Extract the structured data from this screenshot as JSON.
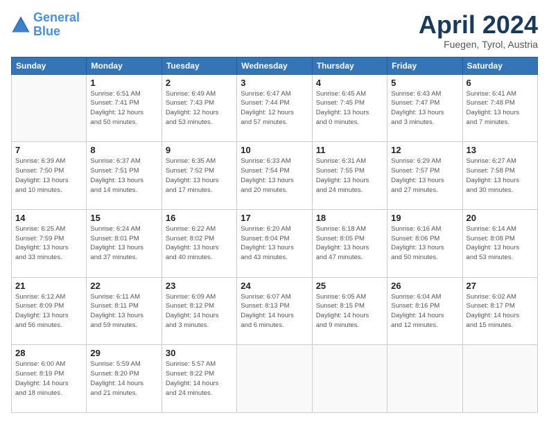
{
  "header": {
    "logo_line1": "General",
    "logo_line2": "Blue",
    "month": "April 2024",
    "location": "Fuegen, Tyrol, Austria"
  },
  "days_of_week": [
    "Sunday",
    "Monday",
    "Tuesday",
    "Wednesday",
    "Thursday",
    "Friday",
    "Saturday"
  ],
  "weeks": [
    [
      {
        "day": "",
        "info": ""
      },
      {
        "day": "1",
        "info": "Sunrise: 6:51 AM\nSunset: 7:41 PM\nDaylight: 12 hours\nand 50 minutes."
      },
      {
        "day": "2",
        "info": "Sunrise: 6:49 AM\nSunset: 7:43 PM\nDaylight: 12 hours\nand 53 minutes."
      },
      {
        "day": "3",
        "info": "Sunrise: 6:47 AM\nSunset: 7:44 PM\nDaylight: 12 hours\nand 57 minutes."
      },
      {
        "day": "4",
        "info": "Sunrise: 6:45 AM\nSunset: 7:45 PM\nDaylight: 13 hours\nand 0 minutes."
      },
      {
        "day": "5",
        "info": "Sunrise: 6:43 AM\nSunset: 7:47 PM\nDaylight: 13 hours\nand 3 minutes."
      },
      {
        "day": "6",
        "info": "Sunrise: 6:41 AM\nSunset: 7:48 PM\nDaylight: 13 hours\nand 7 minutes."
      }
    ],
    [
      {
        "day": "7",
        "info": "Sunrise: 6:39 AM\nSunset: 7:50 PM\nDaylight: 13 hours\nand 10 minutes."
      },
      {
        "day": "8",
        "info": "Sunrise: 6:37 AM\nSunset: 7:51 PM\nDaylight: 13 hours\nand 14 minutes."
      },
      {
        "day": "9",
        "info": "Sunrise: 6:35 AM\nSunset: 7:52 PM\nDaylight: 13 hours\nand 17 minutes."
      },
      {
        "day": "10",
        "info": "Sunrise: 6:33 AM\nSunset: 7:54 PM\nDaylight: 13 hours\nand 20 minutes."
      },
      {
        "day": "11",
        "info": "Sunrise: 6:31 AM\nSunset: 7:55 PM\nDaylight: 13 hours\nand 24 minutes."
      },
      {
        "day": "12",
        "info": "Sunrise: 6:29 AM\nSunset: 7:57 PM\nDaylight: 13 hours\nand 27 minutes."
      },
      {
        "day": "13",
        "info": "Sunrise: 6:27 AM\nSunset: 7:58 PM\nDaylight: 13 hours\nand 30 minutes."
      }
    ],
    [
      {
        "day": "14",
        "info": "Sunrise: 6:25 AM\nSunset: 7:59 PM\nDaylight: 13 hours\nand 33 minutes."
      },
      {
        "day": "15",
        "info": "Sunrise: 6:24 AM\nSunset: 8:01 PM\nDaylight: 13 hours\nand 37 minutes."
      },
      {
        "day": "16",
        "info": "Sunrise: 6:22 AM\nSunset: 8:02 PM\nDaylight: 13 hours\nand 40 minutes."
      },
      {
        "day": "17",
        "info": "Sunrise: 6:20 AM\nSunset: 8:04 PM\nDaylight: 13 hours\nand 43 minutes."
      },
      {
        "day": "18",
        "info": "Sunrise: 6:18 AM\nSunset: 8:05 PM\nDaylight: 13 hours\nand 47 minutes."
      },
      {
        "day": "19",
        "info": "Sunrise: 6:16 AM\nSunset: 8:06 PM\nDaylight: 13 hours\nand 50 minutes."
      },
      {
        "day": "20",
        "info": "Sunrise: 6:14 AM\nSunset: 8:08 PM\nDaylight: 13 hours\nand 53 minutes."
      }
    ],
    [
      {
        "day": "21",
        "info": "Sunrise: 6:12 AM\nSunset: 8:09 PM\nDaylight: 13 hours\nand 56 minutes."
      },
      {
        "day": "22",
        "info": "Sunrise: 6:11 AM\nSunset: 8:11 PM\nDaylight: 13 hours\nand 59 minutes."
      },
      {
        "day": "23",
        "info": "Sunrise: 6:09 AM\nSunset: 8:12 PM\nDaylight: 14 hours\nand 3 minutes."
      },
      {
        "day": "24",
        "info": "Sunrise: 6:07 AM\nSunset: 8:13 PM\nDaylight: 14 hours\nand 6 minutes."
      },
      {
        "day": "25",
        "info": "Sunrise: 6:05 AM\nSunset: 8:15 PM\nDaylight: 14 hours\nand 9 minutes."
      },
      {
        "day": "26",
        "info": "Sunrise: 6:04 AM\nSunset: 8:16 PM\nDaylight: 14 hours\nand 12 minutes."
      },
      {
        "day": "27",
        "info": "Sunrise: 6:02 AM\nSunset: 8:17 PM\nDaylight: 14 hours\nand 15 minutes."
      }
    ],
    [
      {
        "day": "28",
        "info": "Sunrise: 6:00 AM\nSunset: 8:19 PM\nDaylight: 14 hours\nand 18 minutes."
      },
      {
        "day": "29",
        "info": "Sunrise: 5:59 AM\nSunset: 8:20 PM\nDaylight: 14 hours\nand 21 minutes."
      },
      {
        "day": "30",
        "info": "Sunrise: 5:57 AM\nSunset: 8:22 PM\nDaylight: 14 hours\nand 24 minutes."
      },
      {
        "day": "",
        "info": ""
      },
      {
        "day": "",
        "info": ""
      },
      {
        "day": "",
        "info": ""
      },
      {
        "day": "",
        "info": ""
      }
    ]
  ]
}
